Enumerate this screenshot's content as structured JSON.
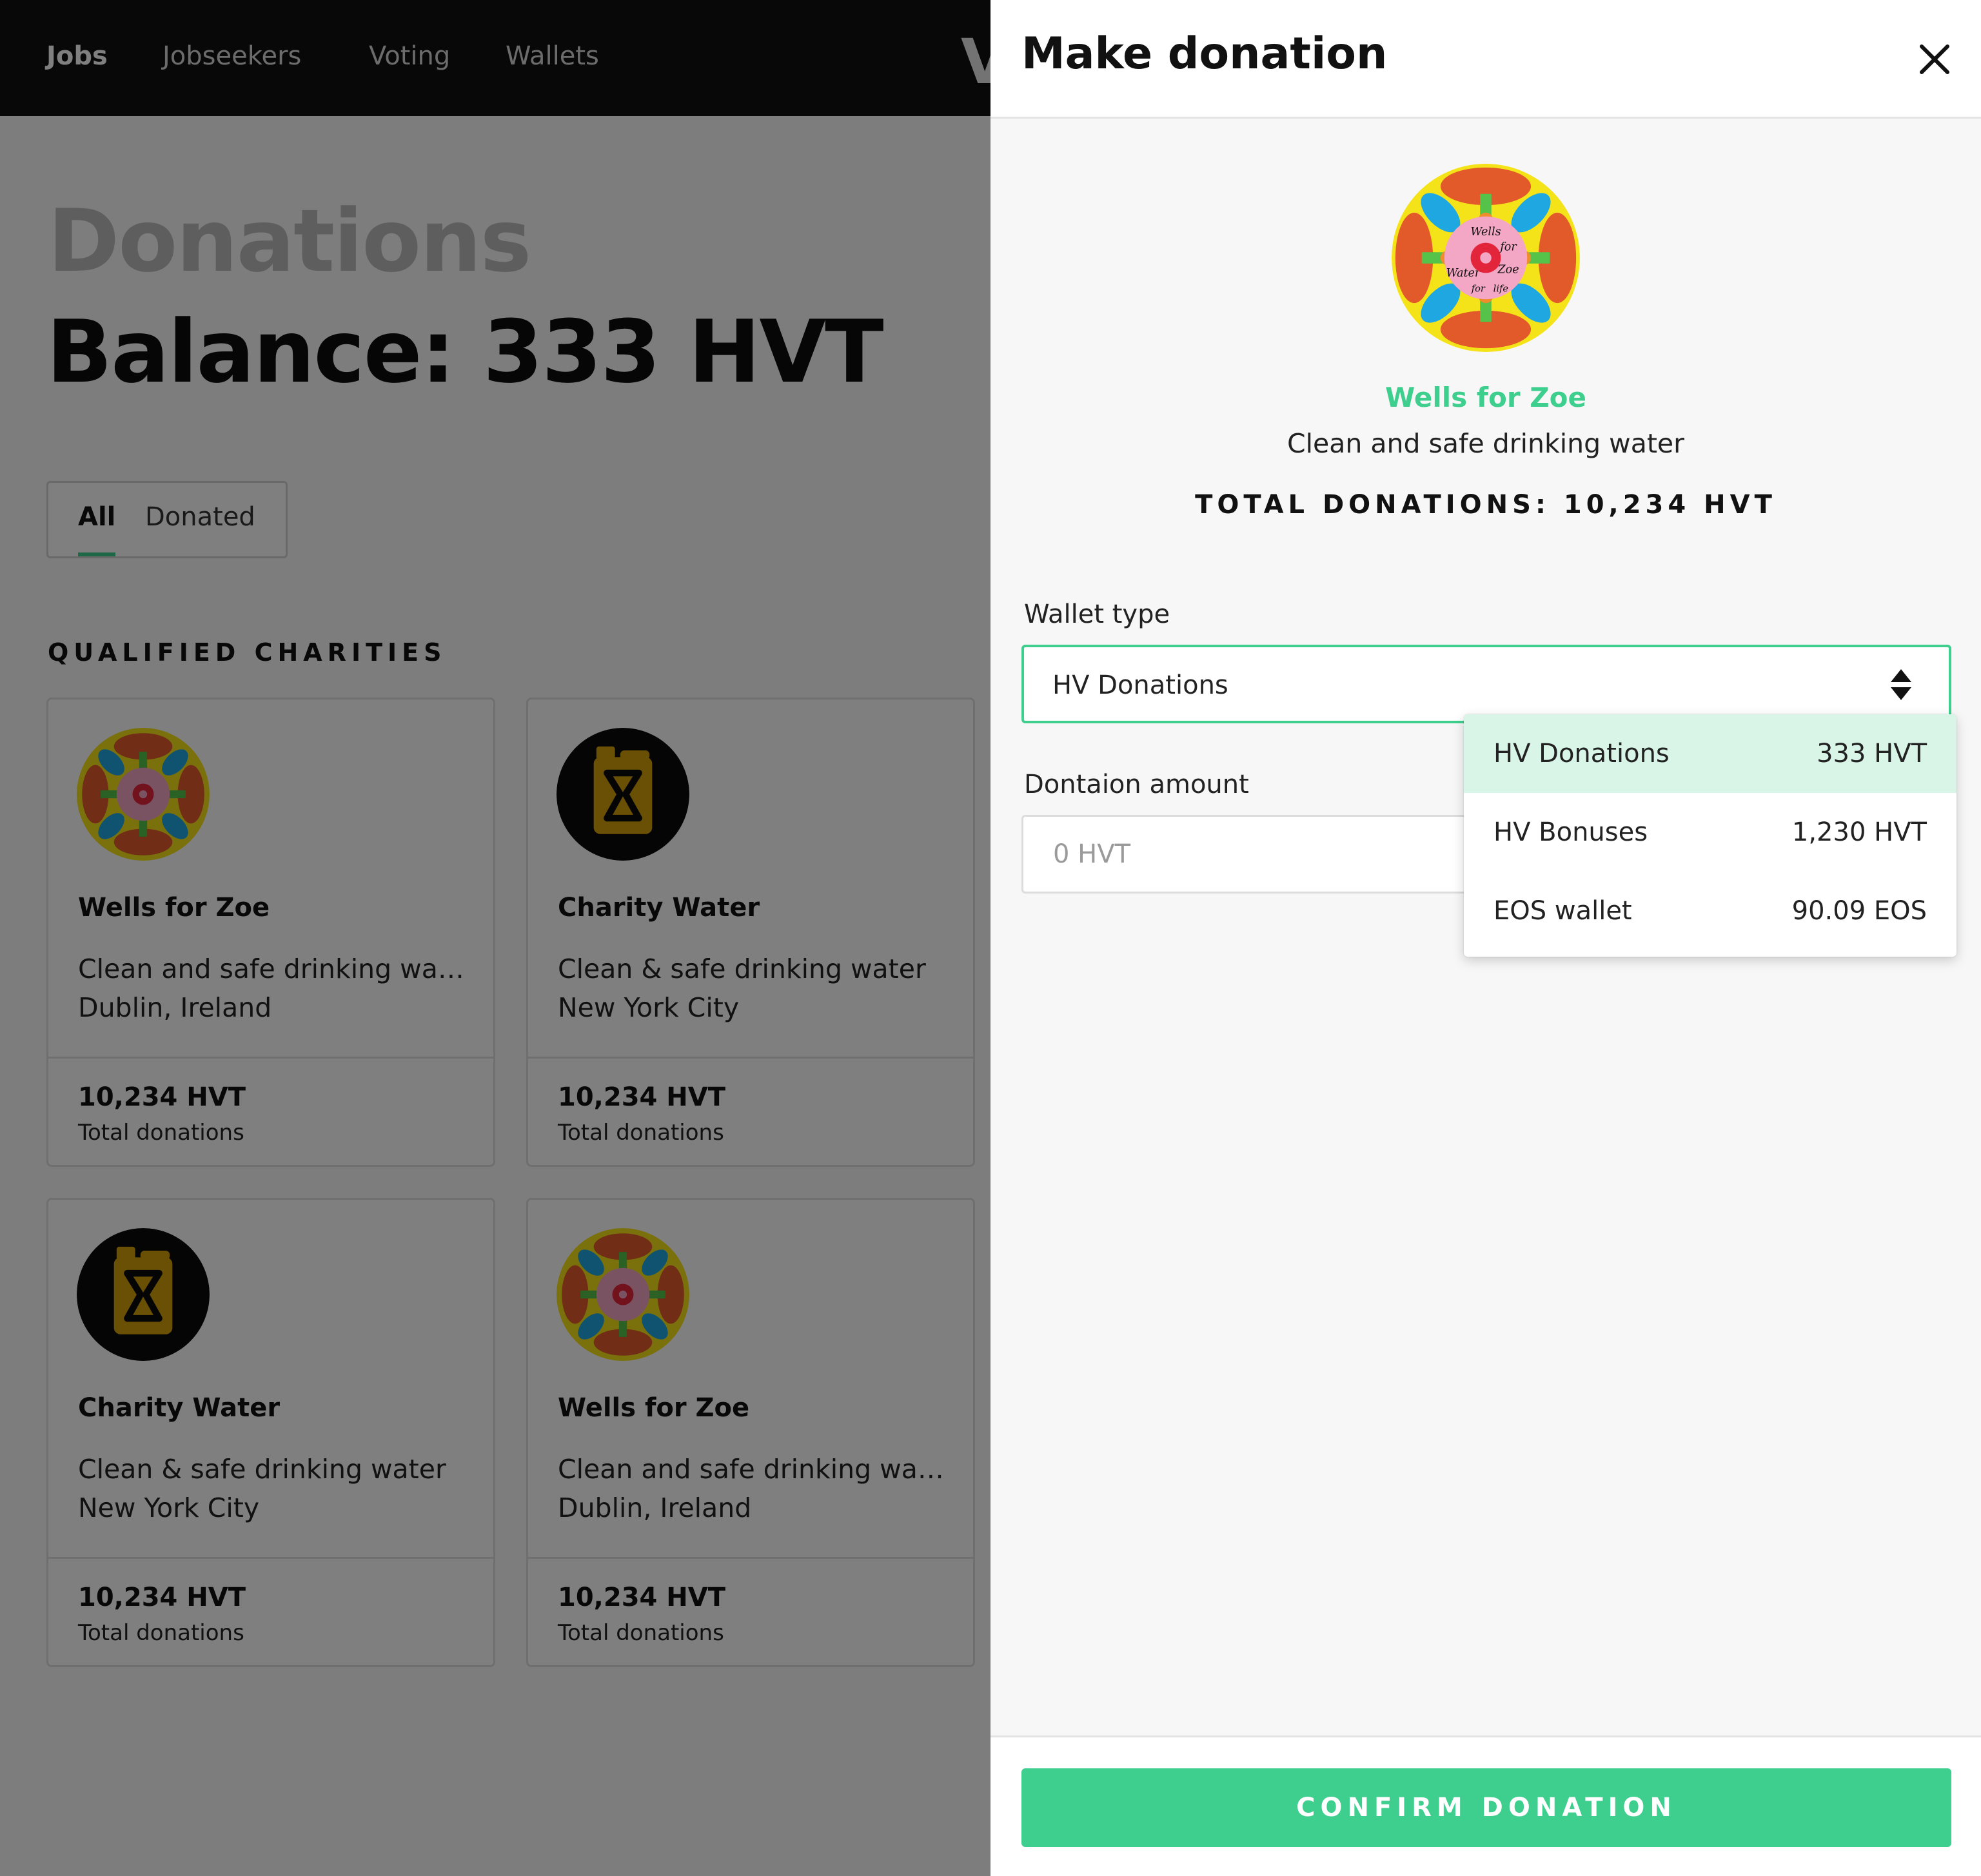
{
  "nav": {
    "items": [
      {
        "label": "Jobs",
        "active": true
      },
      {
        "label": "Jobseekers",
        "active": false
      },
      {
        "label": "Voting",
        "active": false
      },
      {
        "label": "Wallets",
        "active": false
      }
    ]
  },
  "page": {
    "title": "Donations",
    "balance": "Balance: 333 HVT"
  },
  "filter_tabs": [
    {
      "label": "All",
      "active": true
    },
    {
      "label": "Donated",
      "active": false
    }
  ],
  "section_heading": "QUALIFIED CHARITIES",
  "cards": [
    {
      "name": "Wells for Zoe",
      "description": "Clean and safe drinking wa…",
      "location": "Dublin, Ireland",
      "amount": "10,234 HVT",
      "amount_label": "Total donations",
      "logo": "wells-for-zoe-mandala"
    },
    {
      "name": "Charity Water",
      "description": "Clean & safe drinking water",
      "location": "New York City",
      "amount": "10,234 HVT",
      "amount_label": "Total donations",
      "logo": "jerrycan-icon"
    },
    {
      "name": "Charity Water",
      "description": "Clean & safe drinking water",
      "location": "New York City",
      "amount": "10,234 HVT",
      "amount_label": "Total donations",
      "logo": "jerrycan-icon"
    },
    {
      "name": "Wells for Zoe",
      "description": "Clean and safe drinking wa…",
      "location": "Dublin, Ireland",
      "amount": "10,234 HVT",
      "amount_label": "Total donations",
      "logo": "wells-for-zoe-mandala"
    }
  ],
  "panel": {
    "title": "Make donation",
    "charity": {
      "name": "Wells for Zoe",
      "description": "Clean and safe drinking water",
      "total": "TOTAL DONATIONS: 10,234 HVT",
      "logo_text": [
        "Wells",
        "for",
        "Zoe",
        "Water",
        "for",
        "life"
      ]
    },
    "wallet_type_label": "Wallet type",
    "wallet_selected": "HV Donations",
    "amount_label": "Dontaion amount",
    "amount_placeholder": "0 HVT",
    "wallet_options": [
      {
        "name": "HV Donations",
        "value": "333 HVT",
        "selected": true
      },
      {
        "name": "HV Bonuses",
        "value": "1,230 HVT",
        "selected": false
      },
      {
        "name": "EOS wallet",
        "value": "90.09 EOS",
        "selected": false
      }
    ],
    "confirm_label": "CONFIRM DONATION"
  },
  "colors": {
    "accent": "#3ecf8e",
    "accent_light": "#d9f5e8",
    "nav_bg": "#111111",
    "jerrycan": "#d4a10a"
  }
}
